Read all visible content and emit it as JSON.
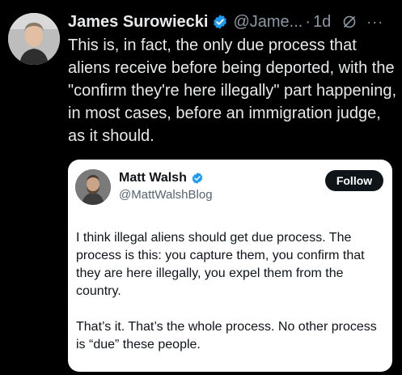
{
  "tweet": {
    "author_name": "James Surowiecki",
    "handle": "@Jame...",
    "separator": "·",
    "time": "1d",
    "more": "···",
    "text": "This is, in fact, the only due process that aliens receive before being deported, with the \"confirm they're here illegally\" part happening, in most cases, before an immigration judge, as it should."
  },
  "quoted": {
    "author_name": "Matt Walsh",
    "handle": "@MattWalshBlog",
    "follow_label": "Follow",
    "paragraph1": "I think illegal aliens should get due process. The process is this: you capture them, you confirm that they are here illegally, you expel them from the country.",
    "paragraph2": "That’s it. That’s the whole process. No other process is “due” these people."
  },
  "icons": {
    "verified": "verified-badge-icon",
    "grok": "grok-slash-icon",
    "more": "more-dots-icon"
  },
  "colors": {
    "background": "#000000",
    "text_primary": "#e7e9ea",
    "text_secondary": "#8b98a5",
    "verified_blue": "#1d9bf0",
    "card_bg": "#ffffff",
    "card_text": "#0f1419",
    "follow_bg": "#0f1419"
  }
}
